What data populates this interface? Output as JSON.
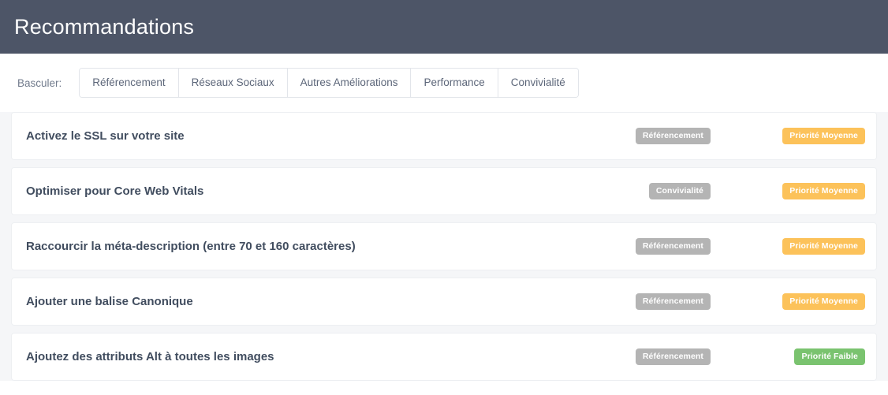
{
  "header": {
    "title": "Recommandations"
  },
  "toggle": {
    "label": "Basculer:",
    "tabs": [
      {
        "label": "Référencement"
      },
      {
        "label": "Réseaux Sociaux"
      },
      {
        "label": "Autres Améliorations"
      },
      {
        "label": "Performance"
      },
      {
        "label": "Convivialité"
      }
    ]
  },
  "colors": {
    "header_bg": "#4d5567",
    "page_bg": "#f5f6f8",
    "category_badge": "#b4b4b4",
    "priority_medium": "#fcc25a",
    "priority_low": "#7ac36f"
  },
  "recommendations": [
    {
      "title": "Activez le SSL sur votre site",
      "category": "Référencement",
      "priority": "Priorité Moyenne",
      "priority_level": "medium"
    },
    {
      "title": "Optimiser pour Core Web Vitals",
      "category": "Convivialité",
      "priority": "Priorité Moyenne",
      "priority_level": "medium"
    },
    {
      "title": "Raccourcir la méta-description (entre 70 et 160 caractères)",
      "category": "Référencement",
      "priority": "Priorité Moyenne",
      "priority_level": "medium"
    },
    {
      "title": "Ajouter une balise Canonique",
      "category": "Référencement",
      "priority": "Priorité Moyenne",
      "priority_level": "medium"
    },
    {
      "title": "Ajoutez des attributs Alt à toutes les images",
      "category": "Référencement",
      "priority": "Priorité Faible",
      "priority_level": "low"
    }
  ]
}
